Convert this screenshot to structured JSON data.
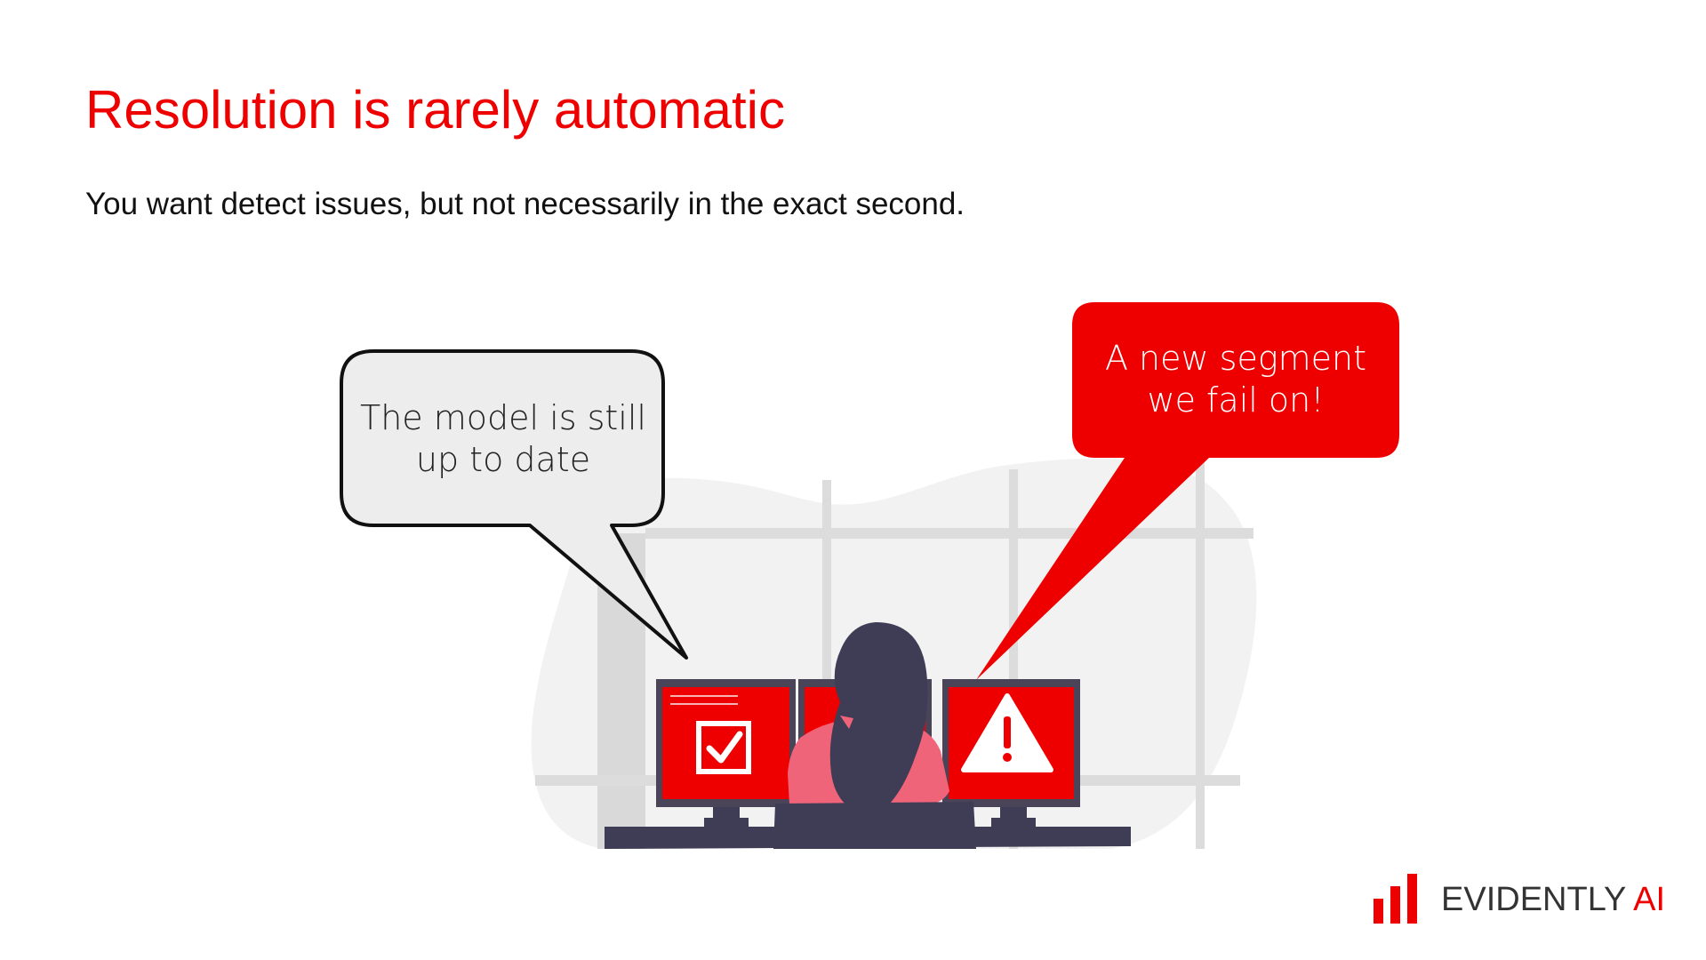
{
  "slide": {
    "title": "Resolution is rarely automatic",
    "subtitle": "You want detect issues, but not necessarily in the exact second."
  },
  "bubbles": {
    "left": {
      "line1": "The model is still",
      "line2": "up to date"
    },
    "right": {
      "line1": "A new segment",
      "line2": "we fail on!"
    }
  },
  "logo": {
    "text_main": "EVIDENTLY",
    "text_accent": "AI"
  },
  "icons": {
    "left_monitor": "checkbox-check-icon",
    "right_monitor": "warning-triangle-icon"
  },
  "colors": {
    "accent": "#ee0000",
    "text": "#111111",
    "bubble_gray": "#ededed",
    "monitor_frame": "#4a4458",
    "person_hair": "#3f3d56",
    "person_shirt": "#f0647a"
  }
}
